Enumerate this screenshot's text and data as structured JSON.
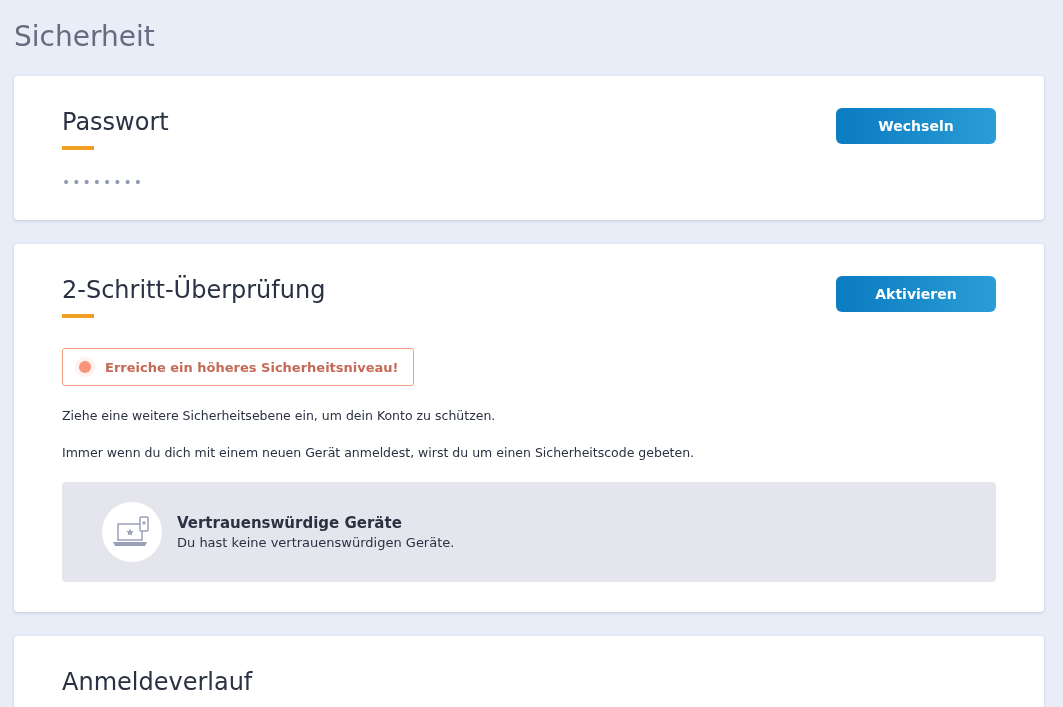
{
  "page_title": "Sicherheit",
  "password": {
    "title": "Passwort",
    "button": "Wechseln",
    "masked_value": "••••••••"
  },
  "two_step": {
    "title": "2-Schritt-Überprüfung",
    "button": "Aktivieren",
    "alert": "Erreiche ein höheres Sicherheitsniveau!",
    "paragraphs": [
      "Ziehe eine weitere Sicherheitsebene ein, um dein Konto zu schützen.",
      "Immer wenn du dich mit einem neuen Gerät anmeldest, wirst du um einen Sicherheitscode gebeten."
    ],
    "devices": {
      "title": "Vertrauenswürdige Geräte",
      "text": "Du hast keine vertrauenswürdigen Geräte."
    }
  },
  "login_history": {
    "title": "Anmeldeverlauf"
  }
}
